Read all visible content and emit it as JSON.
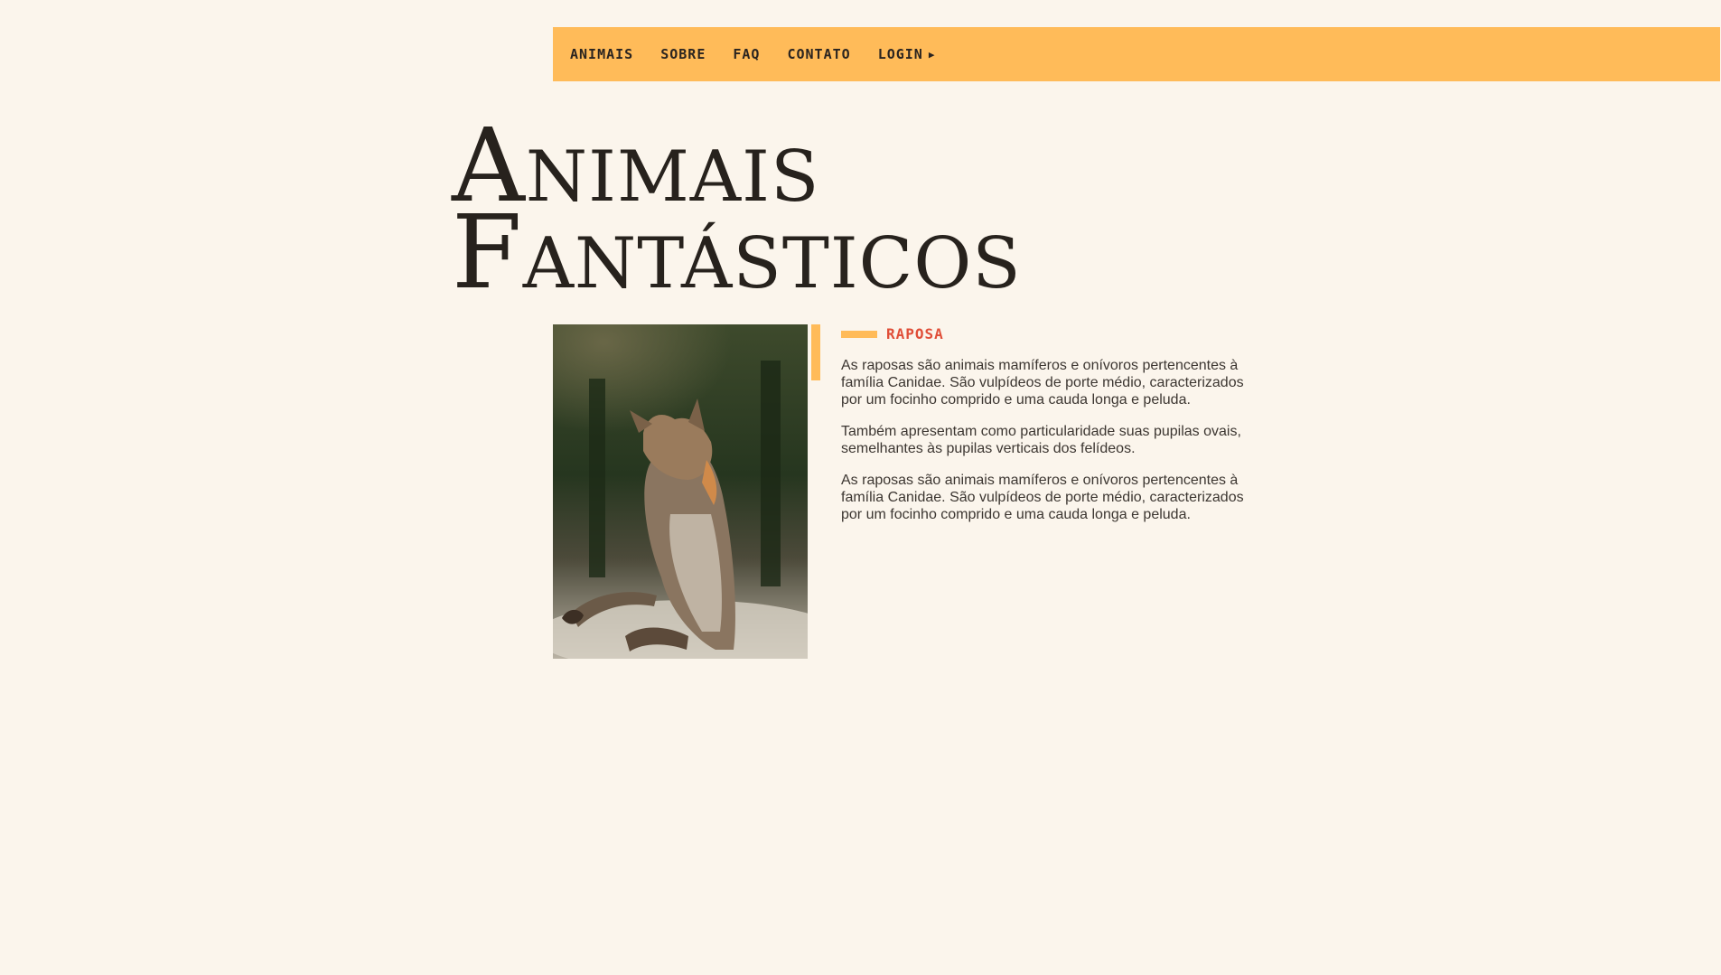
{
  "nav": {
    "items": [
      {
        "label": "ANIMAIS"
      },
      {
        "label": "SOBRE"
      },
      {
        "label": "FAQ"
      },
      {
        "label": "CONTATO"
      },
      {
        "label": "LOGIN"
      }
    ],
    "login_arrow_icon": "triangle-right-icon"
  },
  "hero": {
    "title_line1": "Animais",
    "title_line2": "Fantásticos"
  },
  "animal": {
    "tag": "RAPOSA",
    "paragraphs": [
      "As raposas são animais mamíferos e onívoros pertencentes à família Canidae. São vulpídeos de porte médio, caracterizados por um focinho comprido e uma cauda longa e peluda.",
      "Também apresentam como particularidade suas pupilas ovais, semelhantes às pupilas verticais dos felídeos.",
      "As raposas são animais mamíferos e onívoros pertencentes à família Canidae. São vulpídeos de porte médio, caracterizados por um focinho comprido e uma cauda longa e peluda."
    ]
  },
  "colors": {
    "background": "#fbf5ec",
    "accent": "#ffbb59",
    "tag": "#e04e38",
    "text": "#27221d"
  }
}
